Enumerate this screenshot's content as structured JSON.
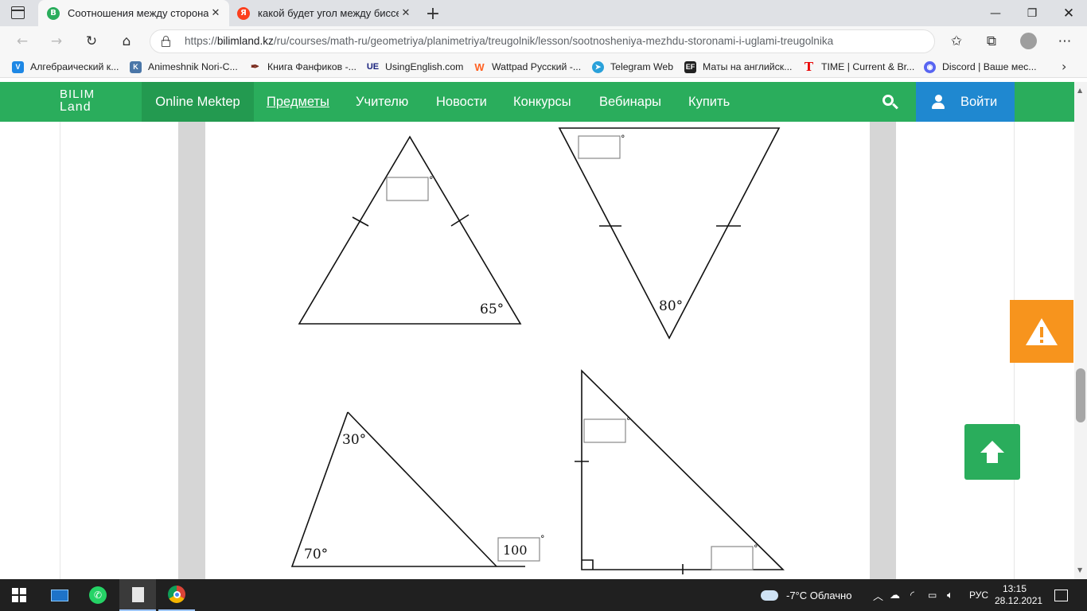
{
  "browser": {
    "tabs": [
      {
        "title": "Соотношения между сторонам",
        "active": true,
        "favicon": "bilimland-icon",
        "favicon_letter": "B",
        "favicon_color": "#2aad5c"
      },
      {
        "title": "какой будет угол между биссек",
        "active": false,
        "favicon": "yandex-icon",
        "favicon_letter": "Я",
        "favicon_color": "#fc3f1d"
      }
    ],
    "url_scheme": "https://",
    "url_host": "bilimland.kz",
    "url_path": "/ru/courses/math-ru/geometriya/planimetriya/treugolnik/lesson/sootnosheniya-mezhdu-storonami-i-uglami-treugolnika",
    "bookmarks": [
      {
        "label": "Алгебраический к...",
        "icon": "book-icon",
        "color": "#1e88e5"
      },
      {
        "label": "Animeshnik Nori-C...",
        "icon": "vk-icon",
        "color": "#4a76a8"
      },
      {
        "label": "Книга Фанфиков -...",
        "icon": "quill-icon",
        "color": "#7a2b1d"
      },
      {
        "label": "UsingEnglish.com",
        "icon": "ue-icon",
        "color": "#1a237e"
      },
      {
        "label": "Wattpad Русский -...",
        "icon": "wattpad-icon",
        "color": "#ff6122"
      },
      {
        "label": "Telegram Web",
        "icon": "telegram-icon",
        "color": "#2aa1da"
      },
      {
        "label": "Маты на английск...",
        "icon": "ef-icon",
        "color": "#222222"
      },
      {
        "label": "TIME | Current & Br...",
        "icon": "time-icon",
        "color": "#e90606"
      },
      {
        "label": "Discord | Ваше мес...",
        "icon": "discord-icon",
        "color": "#5865f2"
      }
    ]
  },
  "site": {
    "logo_line1": "BILIM",
    "logo_line2": "Land",
    "nav": [
      "Online Mektep",
      "Предметы",
      "Учителю",
      "Новости",
      "Конкурсы",
      "Вебинары",
      "Купить"
    ],
    "login_label": "Войти",
    "brand_color": "#2aad5c",
    "warning_color": "#f7941d"
  },
  "figures": {
    "t1_angle_bottom_right": "65°",
    "t2_angle_bottom": "80°",
    "t3_angle_top": "30°",
    "t3_angle_bottom_left": "70°",
    "t3_exterior_answer": "100",
    "degree": "°"
  },
  "taskbar": {
    "weather": "-7°C Облачно",
    "language": "РУС",
    "time": "13:15",
    "date": "28.12.2021"
  }
}
